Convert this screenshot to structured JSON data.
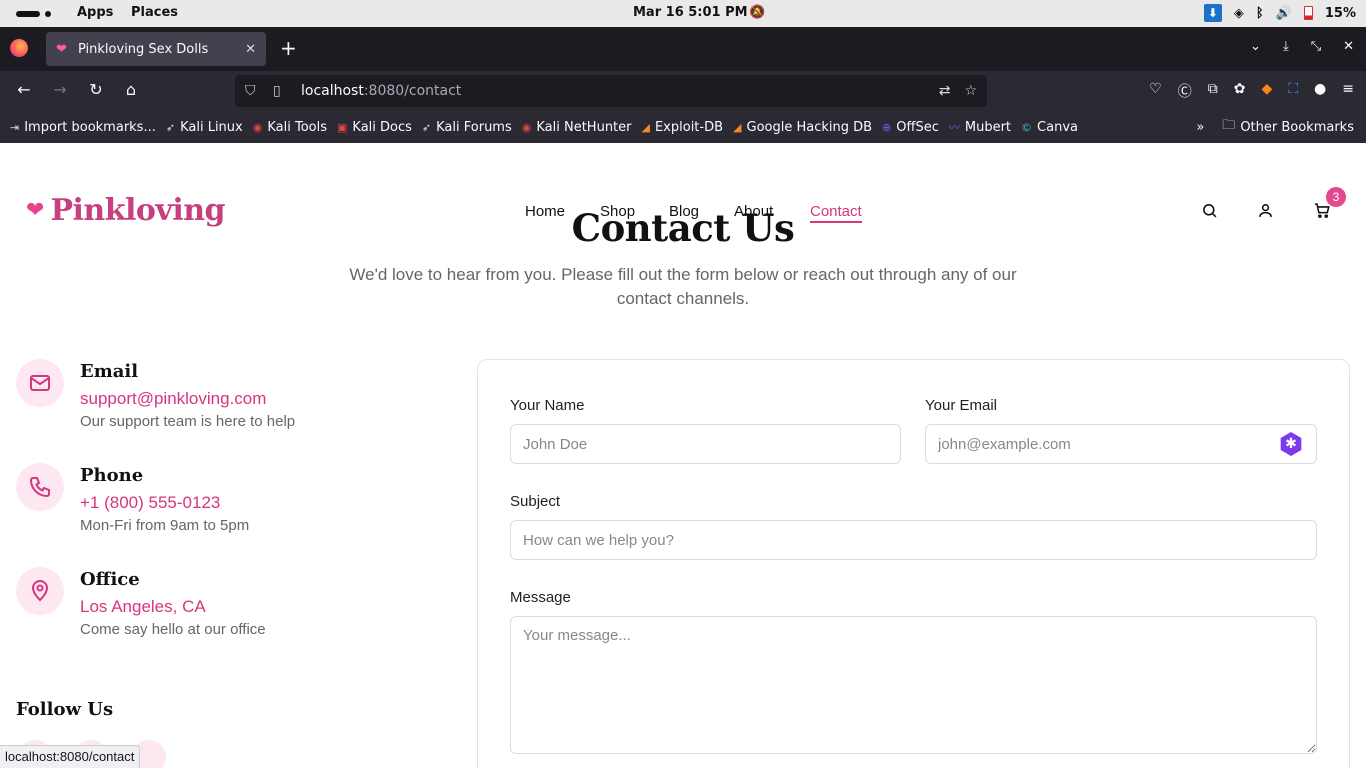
{
  "os": {
    "apps": "Apps",
    "places": "Places",
    "clock": "Mar 16   5:01 PM",
    "battery": "15%"
  },
  "browser": {
    "tab_title": "Pinkloving Sex Dolls",
    "url_host": "localhost",
    "url_rest": ":8080/contact",
    "status_url": "localhost:8080/contact"
  },
  "bookmarks": {
    "items": [
      {
        "label": "Import bookmarks..."
      },
      {
        "label": "Kali Linux"
      },
      {
        "label": "Kali Tools"
      },
      {
        "label": "Kali Docs"
      },
      {
        "label": "Kali Forums"
      },
      {
        "label": "Kali NetHunter"
      },
      {
        "label": "Exploit-DB"
      },
      {
        "label": "Google Hacking DB"
      },
      {
        "label": "OffSec"
      },
      {
        "label": "Mubert"
      },
      {
        "label": "Canva"
      }
    ],
    "other": "Other Bookmarks"
  },
  "site": {
    "brand": "Pinkloving",
    "nav": {
      "home": "Home",
      "shop": "Shop",
      "blog": "Blog",
      "about": "About",
      "contact": "Contact"
    },
    "cart_count": "3",
    "accent_color": "#d6357f"
  },
  "contact": {
    "title": "Contact Us",
    "subtitle": "We'd love to hear from you. Please fill out the form below or reach out through any of our contact channels.",
    "email": {
      "title": "Email",
      "value": "support@pinkloving.com",
      "desc": "Our support team is here to help"
    },
    "phone": {
      "title": "Phone",
      "value": "+1 (800) 555-0123",
      "desc": "Mon-Fri from 9am to 5pm"
    },
    "office": {
      "title": "Office",
      "value": "Los Angeles, CA",
      "desc": "Come say hello at our office"
    },
    "follow": "Follow Us"
  },
  "form": {
    "name_label": "Your Name",
    "name_placeholder": "John Doe",
    "email_label": "Your Email",
    "email_placeholder": "john@example.com",
    "subject_label": "Subject",
    "subject_placeholder": "How can we help you?",
    "message_label": "Message",
    "message_placeholder": "Your message..."
  }
}
